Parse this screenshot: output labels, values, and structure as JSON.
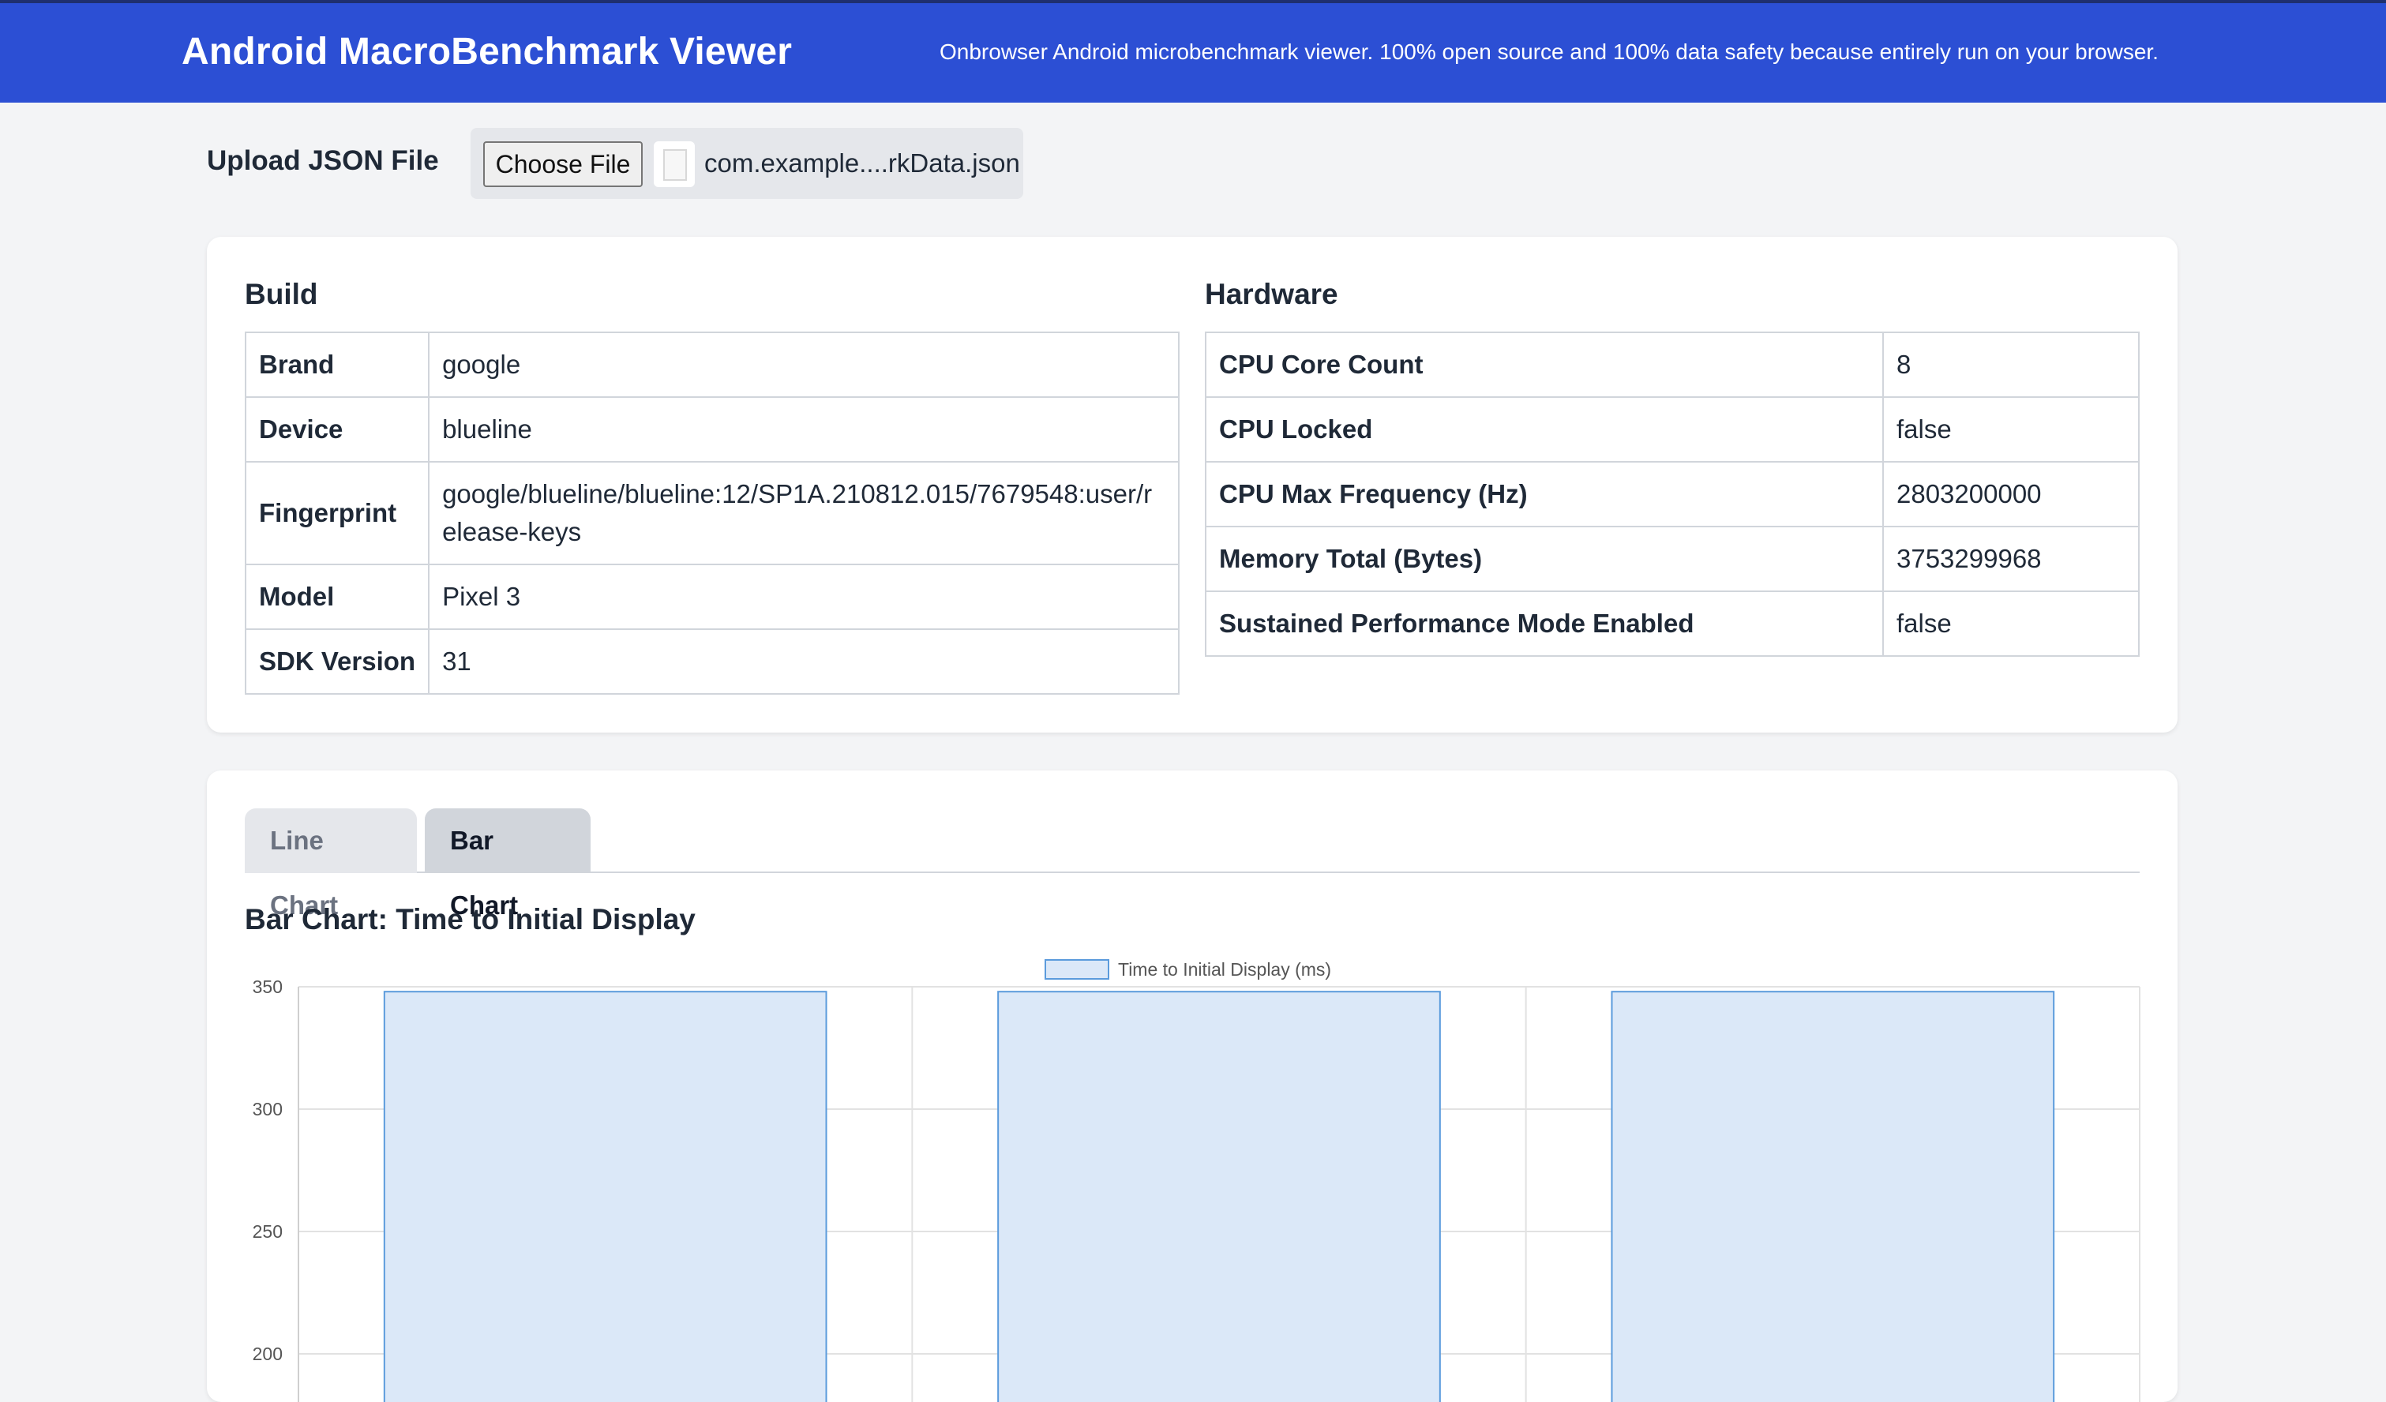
{
  "header": {
    "title": "Android MacroBenchmark Viewer",
    "tagline": "Onbrowser Android microbenchmark viewer. 100% open source and 100% data safety because entirely run on your browser."
  },
  "upload": {
    "label": "Upload JSON File",
    "button_label": "Choose File",
    "file_name": "com.example....rkData.json"
  },
  "build": {
    "title": "Build",
    "rows": [
      {
        "key": "Brand",
        "value": "google"
      },
      {
        "key": "Device",
        "value": "blueline"
      },
      {
        "key": "Fingerprint",
        "value": "google/blueline/blueline:12/SP1A.210812.015/7679548:user/release-keys"
      },
      {
        "key": "Model",
        "value": "Pixel 3"
      },
      {
        "key": "SDK Version",
        "value": "31"
      }
    ]
  },
  "hardware": {
    "title": "Hardware",
    "rows": [
      {
        "key": "CPU Core Count",
        "value": "8"
      },
      {
        "key": "CPU Locked",
        "value": "false"
      },
      {
        "key": "CPU Max Frequency (Hz)",
        "value": "2803200000"
      },
      {
        "key": "Memory Total (Bytes)",
        "value": "3753299968"
      },
      {
        "key": "Sustained Performance Mode Enabled",
        "value": "false"
      }
    ]
  },
  "tabs": [
    {
      "label": "Line Chart",
      "active": false
    },
    {
      "label": "Bar Chart",
      "active": true
    }
  ],
  "chart_section": {
    "title": "Bar Chart: Time to Initial Display"
  },
  "chart_data": {
    "type": "bar",
    "series": [
      {
        "name": "Time to Initial Display (ms)",
        "values": [
          348,
          348,
          348
        ]
      }
    ],
    "yticks": [
      "350",
      "300",
      "250",
      "200"
    ],
    "ylim": [
      200,
      350
    ],
    "grid": true,
    "legend": "top-center",
    "colors": {
      "fill": "#dbe8f8",
      "stroke": "#5b9bdc",
      "legend_fill": "#dbe8f8"
    }
  }
}
